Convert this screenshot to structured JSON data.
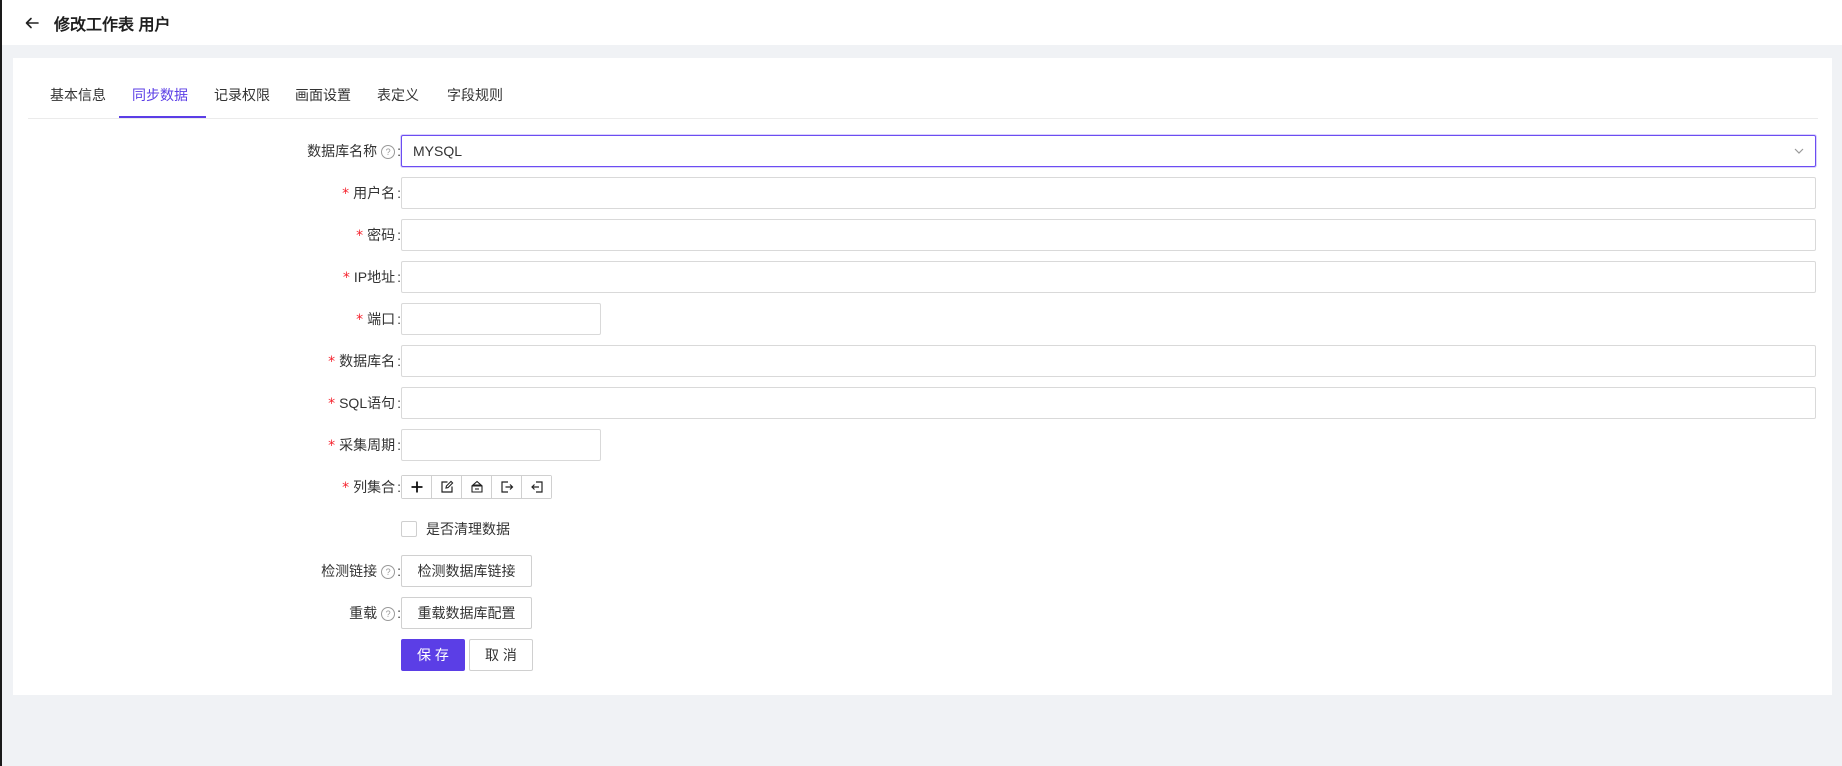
{
  "header": {
    "title": "修改工作表 用户"
  },
  "tabs": [
    {
      "label": "基本信息"
    },
    {
      "label": "同步数据",
      "active": true
    },
    {
      "label": "记录权限"
    },
    {
      "label": "画面设置"
    },
    {
      "label": "表定义"
    },
    {
      "label": "字段规则"
    }
  ],
  "form": {
    "db_type": {
      "label": "数据库名称",
      "value": "MYSQL"
    },
    "username": {
      "label": "用户名",
      "value": ""
    },
    "password": {
      "label": "密码",
      "value": ""
    },
    "ip": {
      "label": "IP地址",
      "value": ""
    },
    "port": {
      "label": "端口",
      "value": ""
    },
    "db_name": {
      "label": "数据库名",
      "value": ""
    },
    "sql": {
      "label": "SQL语句",
      "value": ""
    },
    "period": {
      "label": "采集周期",
      "value": ""
    },
    "columns": {
      "label": "列集合"
    },
    "clean": {
      "label": "是否清理数据",
      "checked": false
    },
    "check_link": {
      "label": "检测链接",
      "button": "检测数据库链接"
    },
    "reload": {
      "label": "重载",
      "button": "重载数据库配置"
    },
    "required_mark": "*",
    "help_mark": "?",
    "colon": ":"
  },
  "actions": {
    "save": "保 存",
    "cancel": "取 消"
  },
  "colors": {
    "accent": "#5b3ee6",
    "required": "#f5222d",
    "background": "#f0f2f5"
  },
  "icons": {
    "back": "arrow-left-icon",
    "dropdown": "chevron-down-icon",
    "toolbar": [
      "plus-icon",
      "edit-icon",
      "sort-icon",
      "import-icon",
      "export-icon"
    ]
  }
}
